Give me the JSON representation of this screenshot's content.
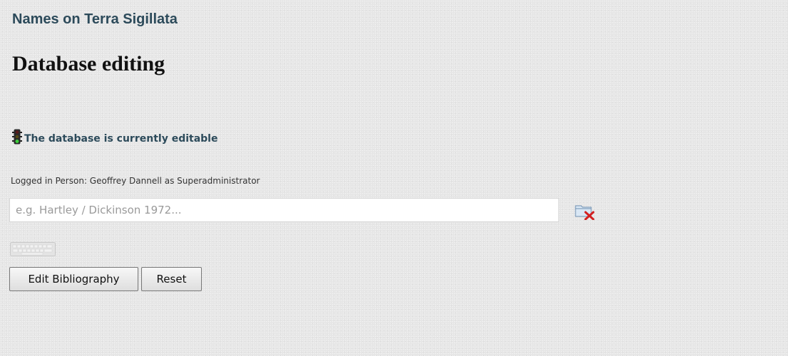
{
  "header": {
    "site_title": "Names on Terra Sigillata",
    "page_title": "Database editing"
  },
  "status": {
    "icon": "traffic-light-icon",
    "text": "The database is currently editable",
    "color": "#2c4a5a"
  },
  "session": {
    "login_text": "Logged in Person: Geoffrey Dannell as Superadministrator"
  },
  "search": {
    "value": "",
    "placeholder": "e.g. Hartley / Dickinson 1972...",
    "clear_icon": "folder-clear-icon",
    "keyboard_icon": "keyboard-icon"
  },
  "actions": {
    "edit_label": "Edit Bibliography",
    "reset_label": "Reset"
  }
}
